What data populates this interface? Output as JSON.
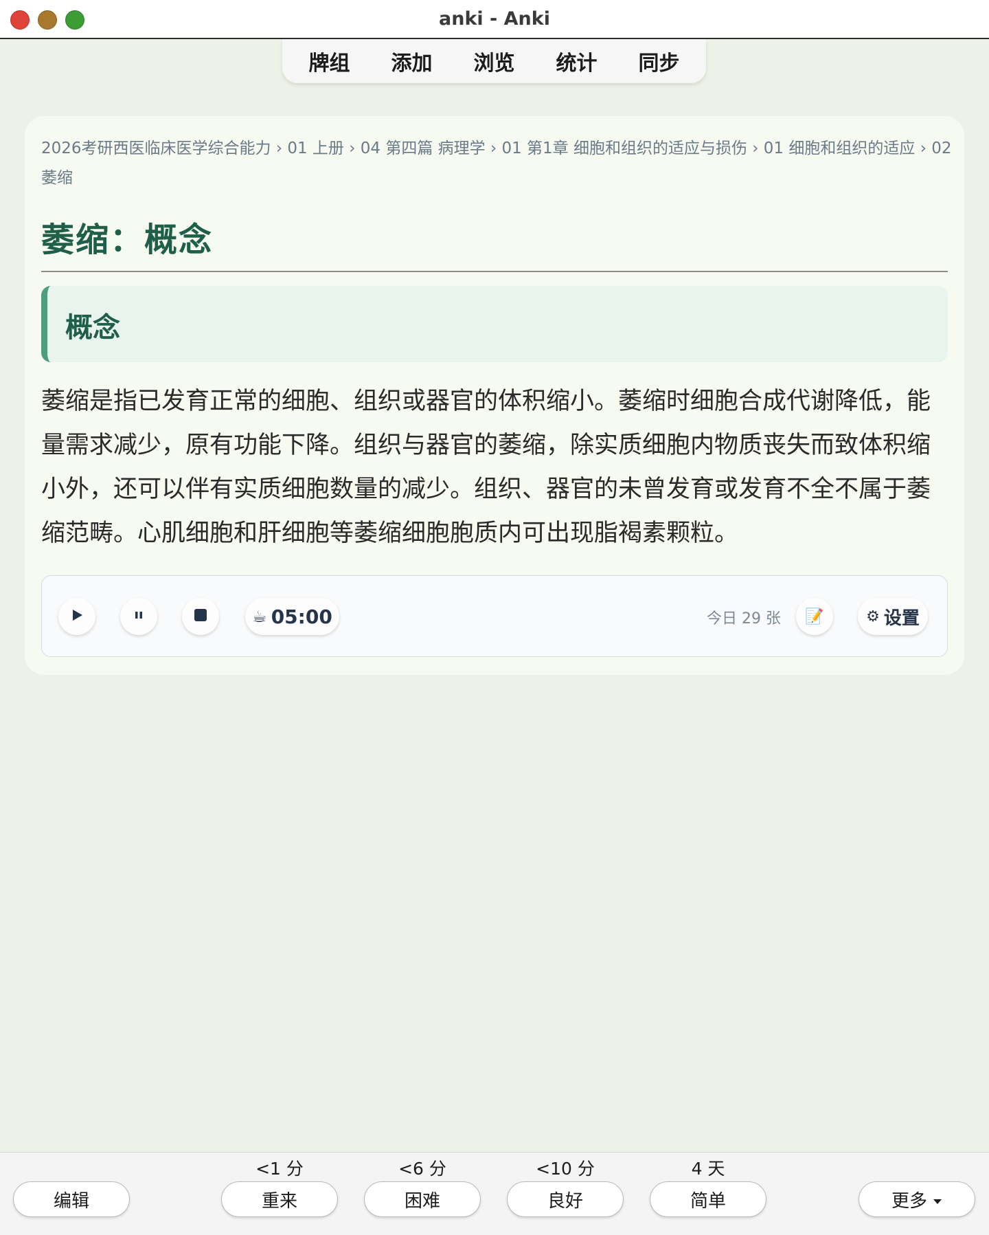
{
  "window": {
    "title": "anki - Anki"
  },
  "nav": {
    "items": [
      "牌组",
      "添加",
      "浏览",
      "统计",
      "同步"
    ]
  },
  "card": {
    "breadcrumb": "2026考研西医临床医学综合能力 › 01 上册 › 04 第四篇 病理学 › 01 第1章 细胞和组织的适应与损伤 › 01 细胞和组织的适应 › 02 萎缩",
    "title": "萎缩：概念",
    "section_heading": "概念",
    "body": "萎缩是指已发育正常的细胞、组织或器官的体积缩小。萎缩时细胞合成代谢降低，能量需求减少，原有功能下降。组织与器官的萎缩，除实质细胞内物质丧失而致体积缩小外，还可以伴有实质细胞数量的减少。组织、器官的未曾发育或发育不全不属于萎缩范畴。心肌细胞和肝细胞等萎缩细胞胞质内可出现脂褐素颗粒。"
  },
  "timer": {
    "play_icon": "play-icon",
    "pause_icon": "pause-icon",
    "stop_icon": "stop-icon",
    "coffee_glyph": "☕",
    "time": "05:00",
    "today_count": "今日 29 张",
    "note_glyph": "📝",
    "settings_glyph": "⚙",
    "settings_label": "设置"
  },
  "bottom": {
    "edit_label": "编辑",
    "more_label": "更多",
    "answers": [
      {
        "label": "重来",
        "interval": "<1 分"
      },
      {
        "label": "困难",
        "interval": "<6 分"
      },
      {
        "label": "良好",
        "interval": "<10 分"
      },
      {
        "label": "简单",
        "interval": "4 天"
      }
    ]
  },
  "colors": {
    "background": "#edf2e8",
    "card": "#f6faf1",
    "accent": "#1f5e48",
    "section_border": "#4e9d7d"
  }
}
